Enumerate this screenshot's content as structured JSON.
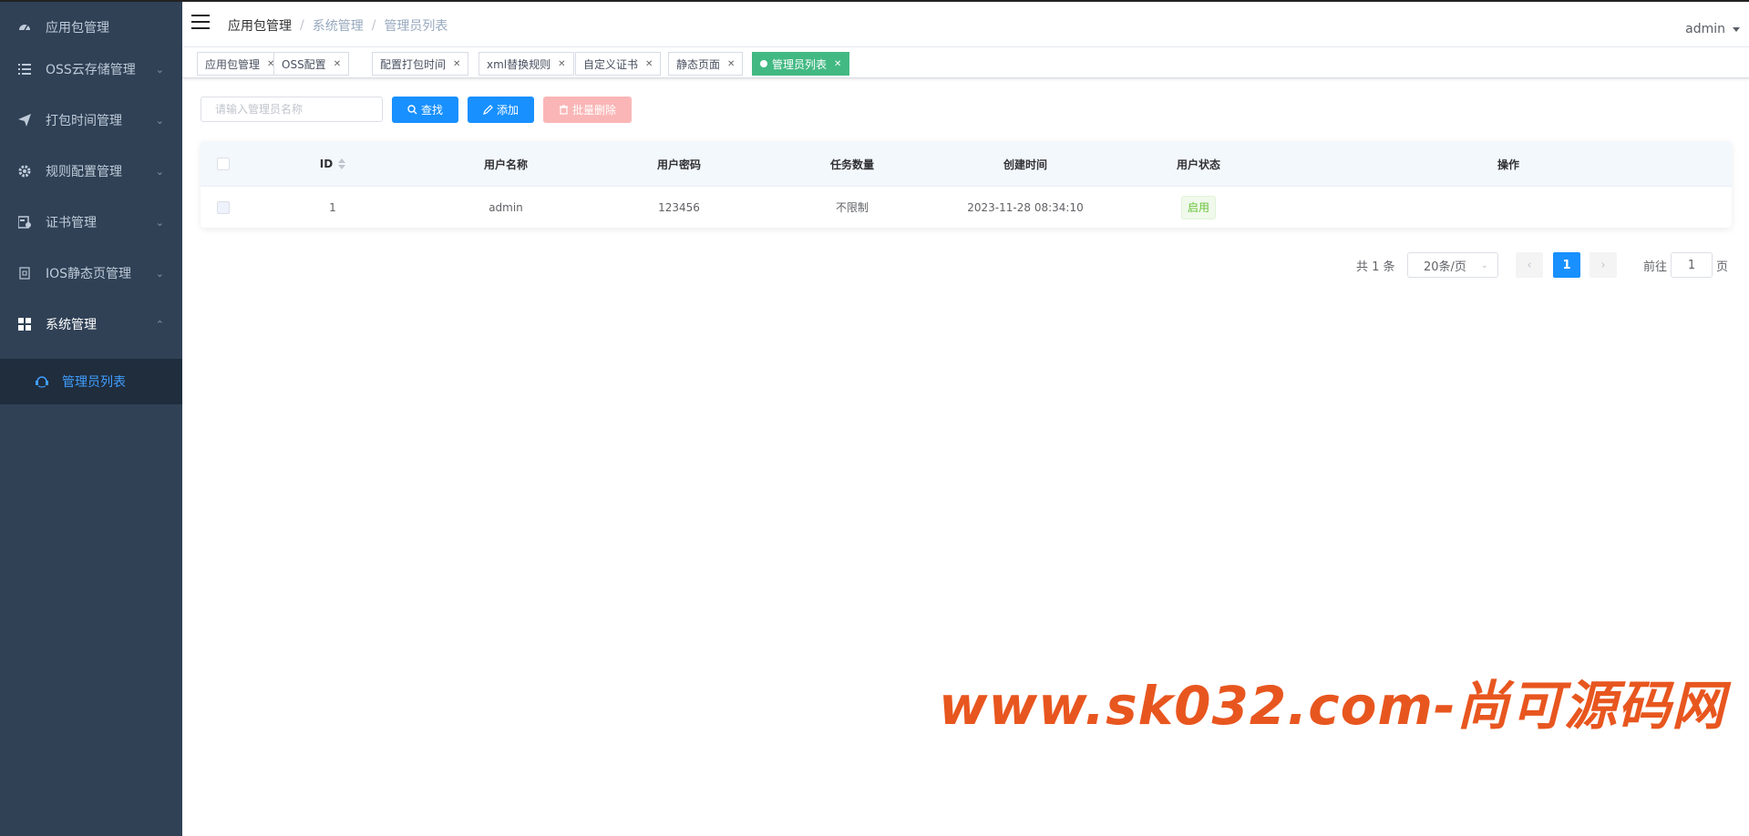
{
  "sidebar": {
    "items": [
      {
        "label": "应用包管理",
        "icon": "dashboard-icon",
        "arrow": ""
      },
      {
        "label": "OSS云存储管理",
        "icon": "list-icon",
        "arrow": "chevron-down"
      },
      {
        "label": "打包时间管理",
        "icon": "send-icon",
        "arrow": "chevron-down"
      },
      {
        "label": "规则配置管理",
        "icon": "gear-icon",
        "arrow": "chevron-down"
      },
      {
        "label": "证书管理",
        "icon": "certificate-icon",
        "arrow": "chevron-down"
      },
      {
        "label": "IOS静态页管理",
        "icon": "page-icon",
        "arrow": "chevron-down"
      },
      {
        "label": "系统管理",
        "icon": "grid-icon",
        "arrow": "chevron-up"
      }
    ],
    "sub_item": {
      "label": "管理员列表",
      "icon": "user-icon"
    }
  },
  "navbar": {
    "breadcrumb": [
      "应用包管理",
      "系统管理",
      "管理员列表"
    ],
    "user": "admin"
  },
  "tags": [
    {
      "label": "应用包管理",
      "active": false
    },
    {
      "label": "OSS配置",
      "active": false
    },
    {
      "label": "配置打包时间",
      "active": false
    },
    {
      "label": "xml替换规则",
      "active": false
    },
    {
      "label": "自定义证书",
      "active": false
    },
    {
      "label": "静态页面",
      "active": false
    },
    {
      "label": "管理员列表",
      "active": true
    }
  ],
  "toolbar": {
    "search_placeholder": "请输入管理员名称",
    "search_label": "查找",
    "add_label": "添加",
    "batch_delete_label": "批量删除"
  },
  "table": {
    "columns": [
      "ID",
      "用户名称",
      "用户密码",
      "任务数量",
      "创建时间",
      "用户状态",
      "操作"
    ],
    "rows": [
      {
        "id": "1",
        "name": "admin",
        "password": "123456",
        "tasks": "不限制",
        "created": "2023-11-28 08:34:10",
        "status": "启用"
      }
    ]
  },
  "pagination": {
    "total_text": "共 1 条",
    "page_size": "20条/页",
    "current_page": "1",
    "goto_label": "前往",
    "goto_value": "1",
    "page_suffix": "页"
  },
  "watermark": "www.sk032.com-尚可源码网",
  "colors": {
    "sidebar_bg": "#304156",
    "primary": "#1890ff",
    "active_tag": "#42b983",
    "danger_light": "#fab6b6"
  }
}
